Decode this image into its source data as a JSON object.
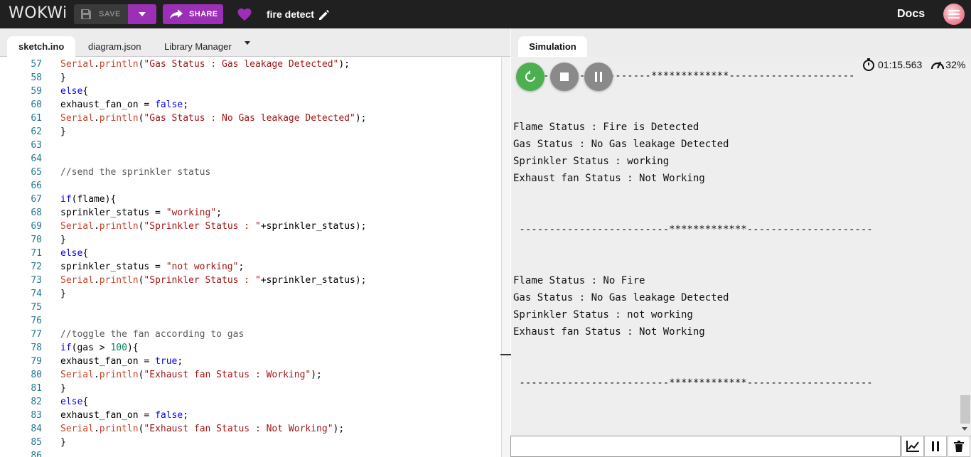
{
  "header": {
    "logo": "WOKWi",
    "save_label": "SAVE",
    "share_label": "SHARE",
    "project_title": "fire detect",
    "docs_label": "Docs"
  },
  "editor_tabs": {
    "sketch": "sketch.ino",
    "diagram": "diagram.json",
    "library": "Library Manager"
  },
  "code_lines": [
    {
      "n": "57",
      "tokens": [
        [
          "obj",
          "Serial"
        ],
        [
          "",
          "."
        ],
        [
          "obj",
          "println"
        ],
        [
          "",
          "("
        ],
        [
          "str",
          "\"Gas Status : Gas leakage Detected\""
        ],
        [
          "",
          ");"
        ]
      ]
    },
    {
      "n": "58",
      "tokens": [
        [
          "",
          "}"
        ]
      ]
    },
    {
      "n": "59",
      "tokens": [
        [
          "kw",
          "else"
        ],
        [
          "",
          "{"
        ]
      ]
    },
    {
      "n": "60",
      "tokens": [
        [
          "",
          "exhaust_fan_on = "
        ],
        [
          "kw",
          "false"
        ],
        [
          "",
          ";"
        ]
      ]
    },
    {
      "n": "61",
      "tokens": [
        [
          "obj",
          "Serial"
        ],
        [
          "",
          "."
        ],
        [
          "obj",
          "println"
        ],
        [
          "",
          "("
        ],
        [
          "str",
          "\"Gas Status : No Gas leakage Detected\""
        ],
        [
          "",
          ");"
        ]
      ]
    },
    {
      "n": "62",
      "tokens": [
        [
          "",
          "}"
        ]
      ]
    },
    {
      "n": "63",
      "tokens": []
    },
    {
      "n": "64",
      "tokens": []
    },
    {
      "n": "65",
      "tokens": [
        [
          "cmt",
          "//send the sprinkler status"
        ]
      ]
    },
    {
      "n": "66",
      "tokens": []
    },
    {
      "n": "67",
      "tokens": [
        [
          "kw",
          "if"
        ],
        [
          "",
          "(flame){"
        ]
      ]
    },
    {
      "n": "68",
      "tokens": [
        [
          "",
          "sprinkler_status = "
        ],
        [
          "str",
          "\"working\""
        ],
        [
          "",
          ";"
        ]
      ]
    },
    {
      "n": "69",
      "tokens": [
        [
          "obj",
          "Serial"
        ],
        [
          "",
          "."
        ],
        [
          "obj",
          "println"
        ],
        [
          "",
          "("
        ],
        [
          "str",
          "\"Sprinkler Status : \""
        ],
        [
          "",
          "+sprinkler_status);"
        ]
      ]
    },
    {
      "n": "70",
      "tokens": [
        [
          "",
          "}"
        ]
      ]
    },
    {
      "n": "71",
      "tokens": [
        [
          "kw",
          "else"
        ],
        [
          "",
          "{"
        ]
      ]
    },
    {
      "n": "72",
      "tokens": [
        [
          "",
          "sprinkler_status = "
        ],
        [
          "str",
          "\"not working\""
        ],
        [
          "",
          ";"
        ]
      ]
    },
    {
      "n": "73",
      "tokens": [
        [
          "obj",
          "Serial"
        ],
        [
          "",
          "."
        ],
        [
          "obj",
          "println"
        ],
        [
          "",
          "("
        ],
        [
          "str",
          "\"Sprinkler Status : \""
        ],
        [
          "",
          "+sprinkler_status);"
        ]
      ]
    },
    {
      "n": "74",
      "tokens": [
        [
          "",
          "}"
        ]
      ]
    },
    {
      "n": "75",
      "tokens": []
    },
    {
      "n": "76",
      "tokens": []
    },
    {
      "n": "77",
      "tokens": [
        [
          "cmt",
          "//toggle the fan according to gas"
        ]
      ]
    },
    {
      "n": "78",
      "tokens": [
        [
          "kw",
          "if"
        ],
        [
          "",
          "(gas > "
        ],
        [
          "num",
          "100"
        ],
        [
          "",
          "){"
        ]
      ]
    },
    {
      "n": "79",
      "tokens": [
        [
          "",
          "exhaust_fan_on = "
        ],
        [
          "kw",
          "true"
        ],
        [
          "",
          ";"
        ]
      ]
    },
    {
      "n": "80",
      "tokens": [
        [
          "obj",
          "Serial"
        ],
        [
          "",
          "."
        ],
        [
          "obj",
          "println"
        ],
        [
          "",
          "("
        ],
        [
          "str",
          "\"Exhaust fan Status : Working\""
        ],
        [
          "",
          ");"
        ]
      ]
    },
    {
      "n": "81",
      "tokens": [
        [
          "",
          "}"
        ]
      ]
    },
    {
      "n": "82",
      "tokens": [
        [
          "kw",
          "else"
        ],
        [
          "",
          "{"
        ]
      ]
    },
    {
      "n": "83",
      "tokens": [
        [
          "",
          "exhaust_fan_on = "
        ],
        [
          "kw",
          "false"
        ],
        [
          "",
          ";"
        ]
      ]
    },
    {
      "n": "84",
      "tokens": [
        [
          "obj",
          "Serial"
        ],
        [
          "",
          "."
        ],
        [
          "obj",
          "println"
        ],
        [
          "",
          "("
        ],
        [
          "str",
          "\"Exhaust fan Status : Not Working\""
        ],
        [
          "",
          ");"
        ]
      ]
    },
    {
      "n": "85",
      "tokens": [
        [
          "",
          "}"
        ]
      ]
    },
    {
      "n": "86",
      "tokens": []
    }
  ],
  "simulation": {
    "tab_label": "Simulation",
    "timer": "01:15.563",
    "speed": "32%",
    "serial_lines": [
      " ----------------------*************---------------------",
      "",
      "",
      "Flame Status : Fire is Detected",
      "Gas Status : No Gas leakage Detected",
      "Sprinkler Status : working",
      "Exhaust fan Status : Not Working",
      "",
      "",
      " -------------------------*************---------------------",
      "",
      "",
      "Flame Status : No Fire",
      "Gas Status : No Gas leakage Detected",
      "Sprinkler Status : not working",
      "Exhaust fan Status : Not Working",
      "",
      "",
      " -------------------------*************---------------------"
    ],
    "serial_input_value": ""
  },
  "colors": {
    "brand_purple": "#9b2fb5",
    "run_green": "#4caf50"
  }
}
